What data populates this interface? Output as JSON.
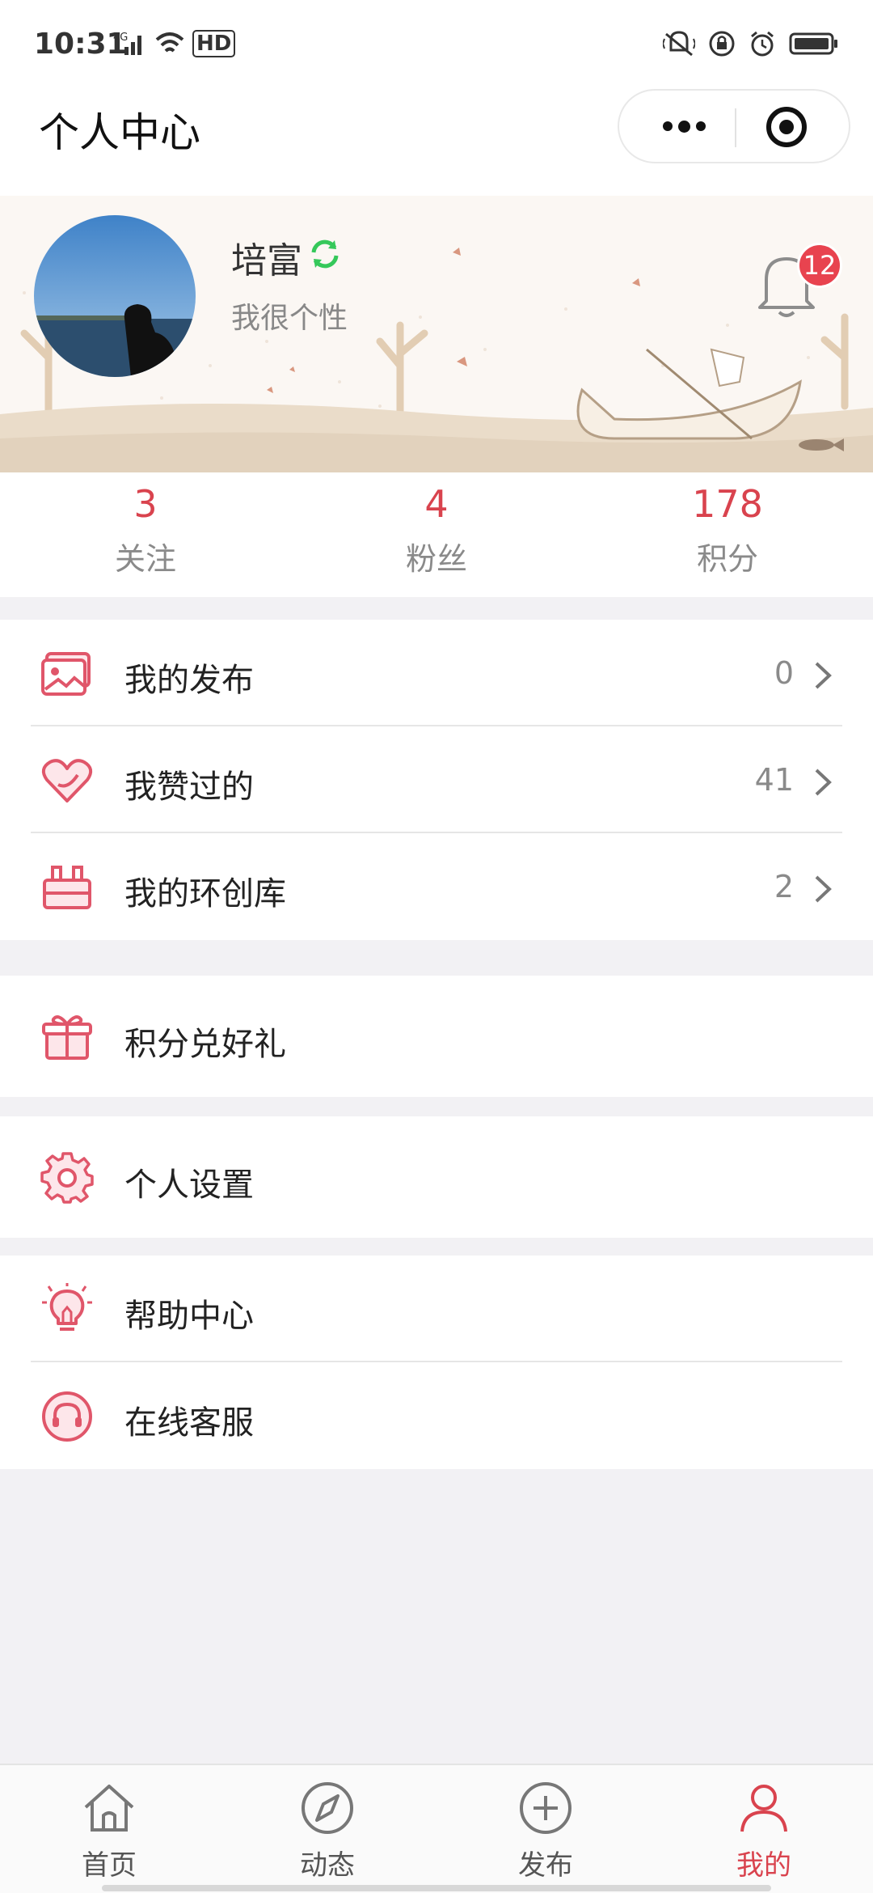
{
  "status_bar": {
    "time": "10:31",
    "network": "4G",
    "hd": "HD"
  },
  "nav": {
    "title": "个人中心"
  },
  "profile": {
    "name": "培富",
    "signature": "我很个性",
    "notification_count": "12"
  },
  "stats": [
    {
      "value": "3",
      "label": "关注"
    },
    {
      "value": "4",
      "label": "粉丝"
    },
    {
      "value": "178",
      "label": "积分"
    }
  ],
  "menu": {
    "group1": [
      {
        "label": "我的发布",
        "count": "0"
      },
      {
        "label": "我赞过的",
        "count": "41"
      },
      {
        "label": "我的环创库",
        "count": "2"
      }
    ],
    "group2": [
      {
        "label": "积分兑好礼"
      }
    ],
    "group3": [
      {
        "label": "个人设置"
      }
    ],
    "group4": [
      {
        "label": "帮助中心"
      },
      {
        "label": "在线客服"
      }
    ]
  },
  "tabs": [
    {
      "label": "首页",
      "icon": "home-icon"
    },
    {
      "label": "动态",
      "icon": "compass-icon"
    },
    {
      "label": "发布",
      "icon": "plus-circle-icon"
    },
    {
      "label": "我的",
      "icon": "user-icon",
      "active": true
    }
  ],
  "colors": {
    "accent": "#d9434e",
    "badge": "#e8434f",
    "icon_red": "#e0566a",
    "sync_green": "#35c85a"
  }
}
